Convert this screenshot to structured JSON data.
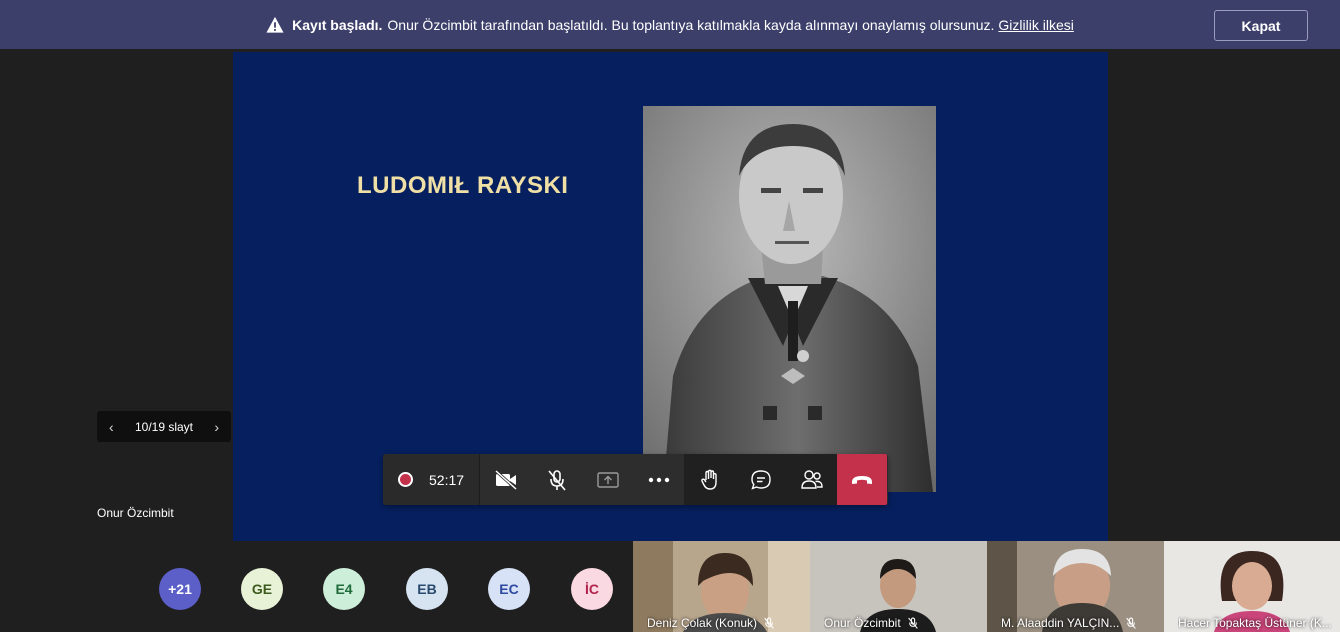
{
  "banner": {
    "title": "Kayıt başladı.",
    "message": "Onur Özcimbit tarafından başlatıldı. Bu toplantıya katılmakla kayda alınmayı onaylamış olursunuz.",
    "link": "Gizlilik ilkesi",
    "close_label": "Kapat"
  },
  "slide": {
    "title": "LUDOMIŁ RAYSKI",
    "counter": "10/19 slayt"
  },
  "presenter": {
    "name": "Onur Özcimbit"
  },
  "controls": {
    "timer": "52:17"
  },
  "participants": {
    "overflow": "+21",
    "avatars": [
      {
        "initials": "GE",
        "bg": "#e8f2d6",
        "fg": "#3e5a1f"
      },
      {
        "initials": "E4",
        "bg": "#cdeed8",
        "fg": "#1f6b3a"
      },
      {
        "initials": "EB",
        "bg": "#d6e4f2",
        "fg": "#2a4a6e"
      },
      {
        "initials": "EC",
        "bg": "#d8e2f7",
        "fg": "#2d4aa0"
      },
      {
        "initials": "İC",
        "bg": "#fad9e2",
        "fg": "#b2244b"
      }
    ],
    "videos": [
      {
        "name": "Deniz Çolak (Konuk)"
      },
      {
        "name": "Onur Özcimbit"
      },
      {
        "name": "M. Alaaddin YALÇIN..."
      },
      {
        "name": "Hacer Topaktaş Üstüner (K..."
      }
    ]
  },
  "colors": {
    "banner": "#3d3f6b",
    "slide_bg": "#06205f",
    "slide_title": "#f1e0a6",
    "hangup": "#c4314b",
    "overflow_avatar": "#5b5fc7"
  }
}
